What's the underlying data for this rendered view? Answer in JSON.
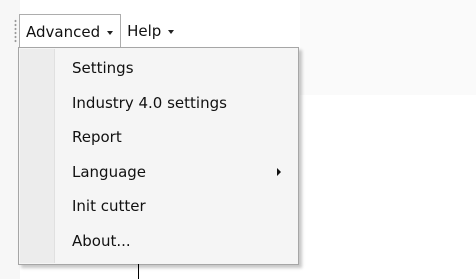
{
  "menubar": {
    "items": [
      {
        "label": "Advanced",
        "open": true
      },
      {
        "label": "Help",
        "open": false
      }
    ]
  },
  "dropdown": {
    "items": [
      {
        "label": "Settings",
        "has_submenu": false
      },
      {
        "label": "Industry 4.0 settings",
        "has_submenu": false
      },
      {
        "label": "Report",
        "has_submenu": false
      },
      {
        "label": "Language",
        "has_submenu": true
      },
      {
        "label": "Init cutter",
        "has_submenu": false
      },
      {
        "label": "About...",
        "has_submenu": false
      }
    ]
  }
}
